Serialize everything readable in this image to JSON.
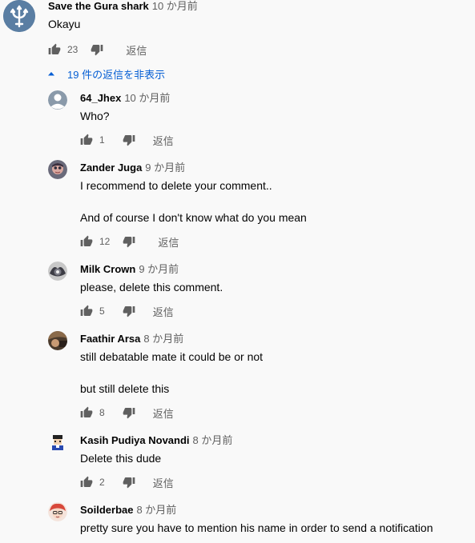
{
  "top_comment": {
    "author": "Save the Gura shark",
    "time": "10 か月前",
    "text": "Okayu",
    "likes": "23",
    "reply": "返信"
  },
  "toggle_replies": "19 件の返信を非表示",
  "replies": [
    {
      "author": "64_Jhex",
      "time": "10 か月前",
      "text": "Who?",
      "likes": "1",
      "reply": "返信"
    },
    {
      "author": "Zander Juga",
      "time": "9 か月前",
      "text": "I recommend to delete your comment..\n\nAnd of course I don't know what do you mean",
      "likes": "12",
      "reply": "返信"
    },
    {
      "author": "Milk Crown",
      "time": "9 か月前",
      "text": "please, delete this comment.",
      "likes": "5",
      "reply": "返信"
    },
    {
      "author": "Faathir Arsa",
      "time": "8 か月前",
      "text": "still debatable mate it could be or not\n\nbut still delete this",
      "likes": "8",
      "reply": "返信"
    },
    {
      "author": "Kasih Pudiya Novandi",
      "time": "8 か月前",
      "text": "Delete this dude",
      "likes": "2",
      "reply": "返信"
    },
    {
      "author": "Soilderbae",
      "time": "8 か月前",
      "text": "pretty sure you have to mention his name in order to send a notification",
      "likes": "",
      "reply": ""
    }
  ],
  "colors": {
    "link_blue": "#065fd4",
    "secondary_text": "#606060",
    "trident_avatar_bg": "#4a6d92"
  }
}
